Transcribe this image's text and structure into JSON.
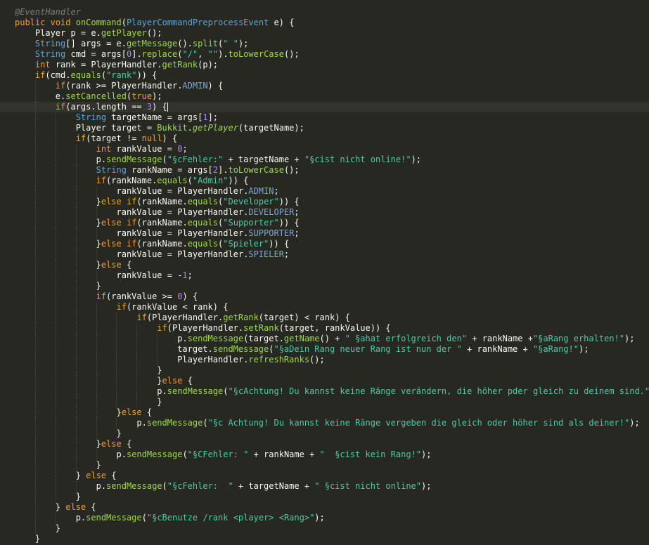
{
  "editor": {
    "language": "Java",
    "caret_line": 10,
    "lines": [
      "@EventHandler",
      "public void onCommand(PlayerCommandPreprocessEvent e) {",
      "    Player p = e.getPlayer();",
      "    String[] args = e.getMessage().split(\" \");",
      "    String cmd = args[0].replace(\"/\", \"\").toLowerCase();",
      "    int rank = PlayerHandler.getRank(p);",
      "    if(cmd.equals(\"rank\")) {",
      "        if(rank >= PlayerHandler.ADMIN) {",
      "        e.setCancelled(true);",
      "        if(args.length == 3) {",
      "            String targetName = args[1];",
      "            Player target = Bukkit.getPlayer(targetName);",
      "            if(target != null) {",
      "                int rankValue = 0;",
      "                p.sendMessage(\"§cFehler:\" + targetName + \"§cist nicht online!\");",
      "                String rankName = args[2].toLowerCase();",
      "                if(rankName.equals(\"Admin\")) {",
      "                    rankValue = PlayerHandler.ADMIN;",
      "                }else if(rankName.equals(\"Developer\")) {",
      "                    rankValue = PlayerHandler.DEVELOPER;",
      "                }else if(rankName.equals(\"Supporter\")) {",
      "                    rankValue = PlayerHandler.SUPPORTER;",
      "                }else if(rankName.equals(\"Spieler\")) {",
      "                    rankValue = PlayerHandler.SPIELER;",
      "                }else {",
      "                    rankValue = -1;",
      "                }",
      "                if(rankValue >= 0) {",
      "                    if(rankValue < rank) {",
      "                        if(PlayerHandler.getRank(target) < rank) {",
      "                            if(PlayerHandler.setRank(target, rankValue)) {",
      "                                p.sendMessage(target.getName() + \" §ahat erfolgreich den\" + rankName +\"§aRang erhalten!\");",
      "                                target.sendMessage(\"§aDein Rang neuer Rang ist nun der \" + rankName + \"§aRang!\");",
      "                                PlayerHandler.refreshRanks();",
      "                            }",
      "                            }else {",
      "                            p.sendMessage(\"§cAchtung! Du kannst keine Ränge verändern, die höher pder gleich zu deinem sind.\");",
      "                            }",
      "                    }else {",
      "                        p.sendMessage(\"§c Achtung! Du kannst keine Ränge vergeben die gleich oder höher sind als deiner!\");",
      "                    }",
      "                }else {",
      "                    p.sendMessage(\"§CFehler: \" + rankName + \"  §cist kein Rang!\");",
      "                }",
      "            } else {",
      "                p.sendMessage(\"§cFehler:  \" + targetName + \" §cist nicht online\");",
      "            }",
      "        } else {",
      "            p.sendMessage(\"§cBenutze /rank <player> <Rang>\");",
      "        }",
      "    }"
    ]
  }
}
